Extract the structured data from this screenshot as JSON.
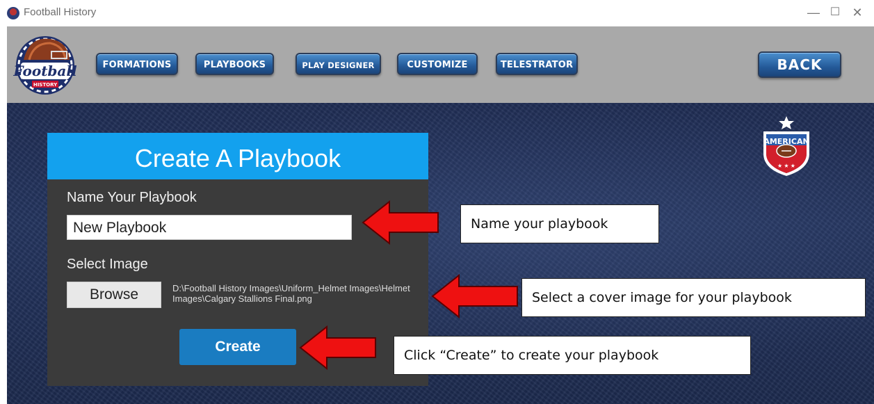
{
  "window": {
    "title": "Football History",
    "controls": {
      "minimize": "—",
      "maximize": "☐",
      "close": "✕"
    }
  },
  "toolbar": {
    "logo": {
      "text": "Football",
      "sub": "HISTORY"
    },
    "nav": [
      "FORMATIONS",
      "PLAYBOOKS",
      "PLAY DESIGNER",
      "CUSTOMIZE",
      "TELESTRATOR"
    ],
    "back_label": "BACK"
  },
  "badge": {
    "text": "AMERICAN"
  },
  "dialog": {
    "title": "Create A Playbook",
    "name_label": "Name Your Playbook",
    "name_value": "New Playbook",
    "image_label": "Select Image",
    "browse_label": "Browse",
    "image_path": "D:\\Football History Images\\Uniform_Helmet Images\\Helmet Images\\Calgary Stallions Final.png",
    "create_label": "Create"
  },
  "callouts": {
    "name": "Name your playbook",
    "image": "Select a cover image for your playbook",
    "create": "Click “Create” to create your playbook"
  },
  "colors": {
    "header_blue": "#13a1ee",
    "create_blue": "#1a7cc1",
    "arrow_red": "#ee1111",
    "panel": "#3b3b3b"
  }
}
